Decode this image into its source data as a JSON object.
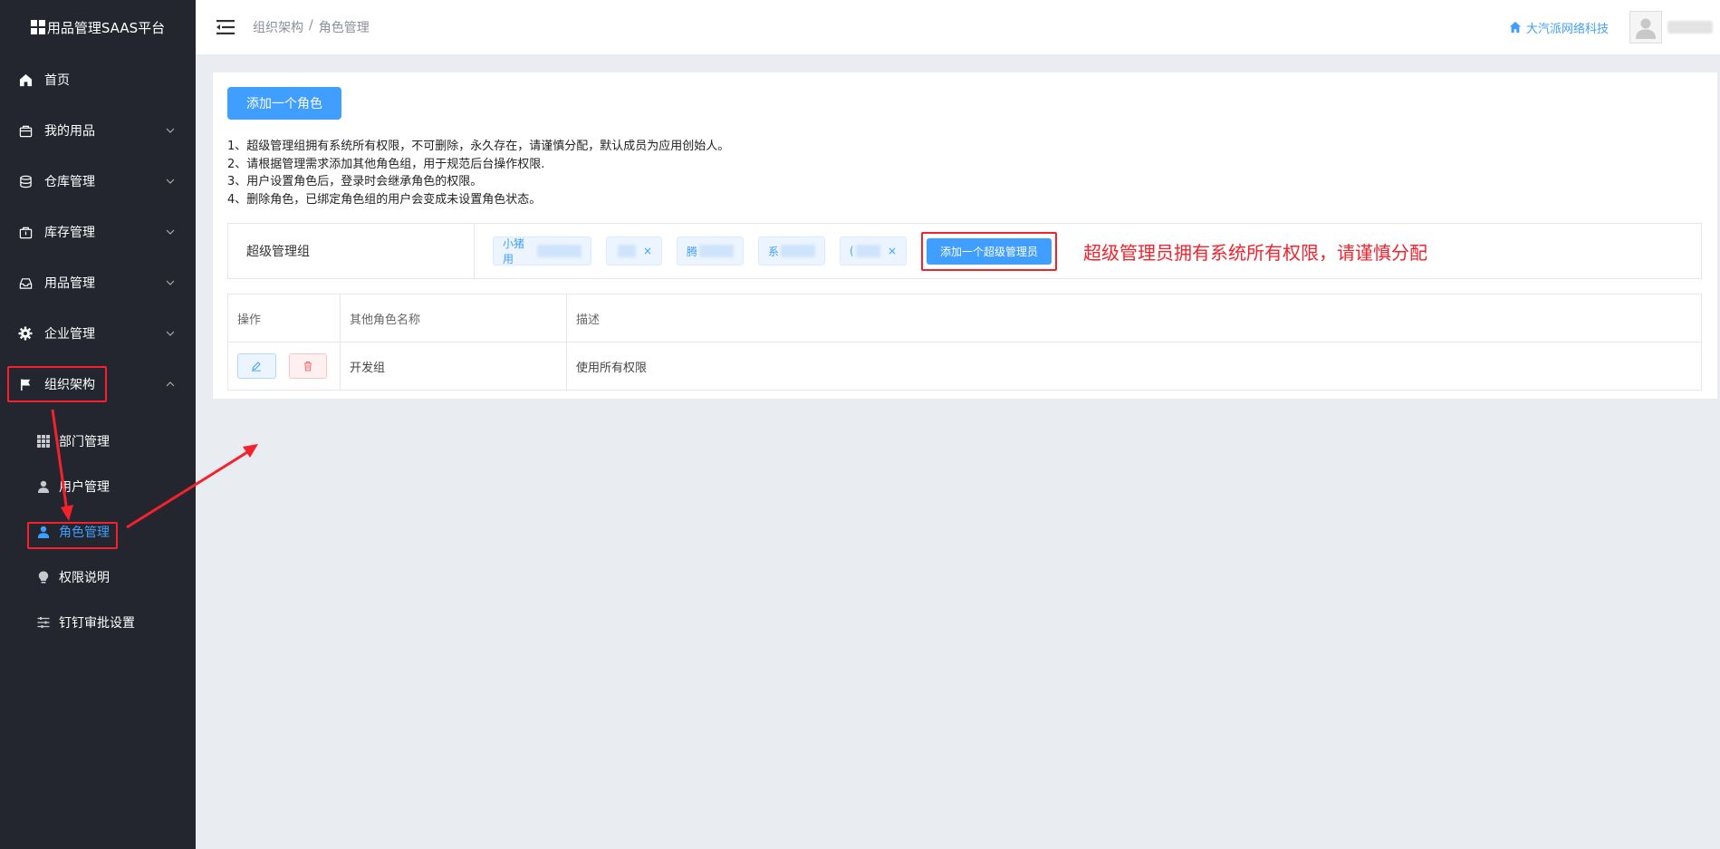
{
  "app": {
    "title": "用品管理SAAS平台"
  },
  "sidebar": {
    "items": [
      {
        "label": "首页",
        "icon": "home-icon"
      },
      {
        "label": "我的用品",
        "icon": "bag-icon"
      },
      {
        "label": "仓库管理",
        "icon": "database-icon"
      },
      {
        "label": "库存管理",
        "icon": "box-icon"
      },
      {
        "label": "用品管理",
        "icon": "inbox-icon"
      },
      {
        "label": "企业管理",
        "icon": "gear-icon"
      },
      {
        "label": "组织架构",
        "icon": "flag-icon"
      }
    ],
    "subitems": [
      {
        "label": "部门管理",
        "icon": "grid-icon"
      },
      {
        "label": "用户管理",
        "icon": "user-icon"
      },
      {
        "label": "角色管理",
        "icon": "user-badge-icon"
      },
      {
        "label": "权限说明",
        "icon": "bulb-icon"
      },
      {
        "label": "钉钉审批设置",
        "icon": "sliders-icon"
      }
    ]
  },
  "header": {
    "breadcrumb": [
      "组织架构",
      "角色管理"
    ],
    "separator": "/",
    "company": "大汽派网络科技"
  },
  "main": {
    "add_role_label": "添加一个角色",
    "notes": [
      "1、超级管理组拥有系统所有权限，不可删除，永久存在，请谨慎分配，默认成员为应用创始人。",
      "2、请根据管理需求添加其他角色组，用于规范后台操作权限.",
      "3、用户设置角色后，登录时会继承角色的权限。",
      "4、删除角色，已绑定角色组的用户会变成未设置角色状态。"
    ],
    "super_group": {
      "label": "超级管理组",
      "members": [
        "小猪用",
        "",
        "腾",
        "系",
        "("
      ],
      "add_label": "添加一个超级管理员"
    },
    "annotation": "超级管理员拥有系统所有权限，请谨慎分配",
    "table": {
      "headers": [
        "操作",
        "其他角色名称",
        "描述"
      ],
      "rows": [
        {
          "name": "开发组",
          "desc": "使用所有权限"
        }
      ]
    }
  },
  "colors": {
    "primary": "#409eff",
    "sidebar_bg": "#23262e",
    "annotation": "#f5222d"
  }
}
